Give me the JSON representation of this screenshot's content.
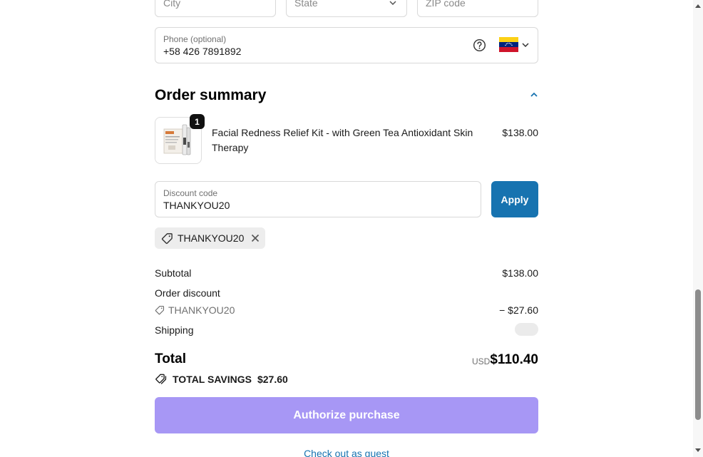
{
  "address": {
    "city_placeholder": "City",
    "state_placeholder": "State",
    "zip_placeholder": "ZIP code"
  },
  "phone": {
    "label": "Phone (optional)",
    "value": "+58 426 7891892",
    "country_flag": "venezuela-flag-icon"
  },
  "order_summary": {
    "title": "Order summary",
    "item": {
      "quantity": "1",
      "name": "Facial Redness Relief Kit - with Green Tea Antioxidant Skin Therapy",
      "price": "$138.00"
    }
  },
  "discount": {
    "label": "Discount code",
    "value": "THANKYOU20",
    "apply_label": "Apply",
    "applied_code": "THANKYOU20"
  },
  "totals": {
    "subtotal_label": "Subtotal",
    "subtotal_value": "$138.00",
    "order_discount_label": "Order discount",
    "discount_code": "THANKYOU20",
    "discount_value": "− $27.60",
    "shipping_label": "Shipping",
    "total_label": "Total",
    "currency": "USD",
    "total_value": "$110.40",
    "savings_label": "TOTAL SAVINGS",
    "savings_value": "$27.60"
  },
  "actions": {
    "authorize_label": "Authorize purchase",
    "guest_label": "Check out as guest"
  },
  "colors": {
    "accent": "#1773b0",
    "authorize_button": "#a797f5"
  }
}
